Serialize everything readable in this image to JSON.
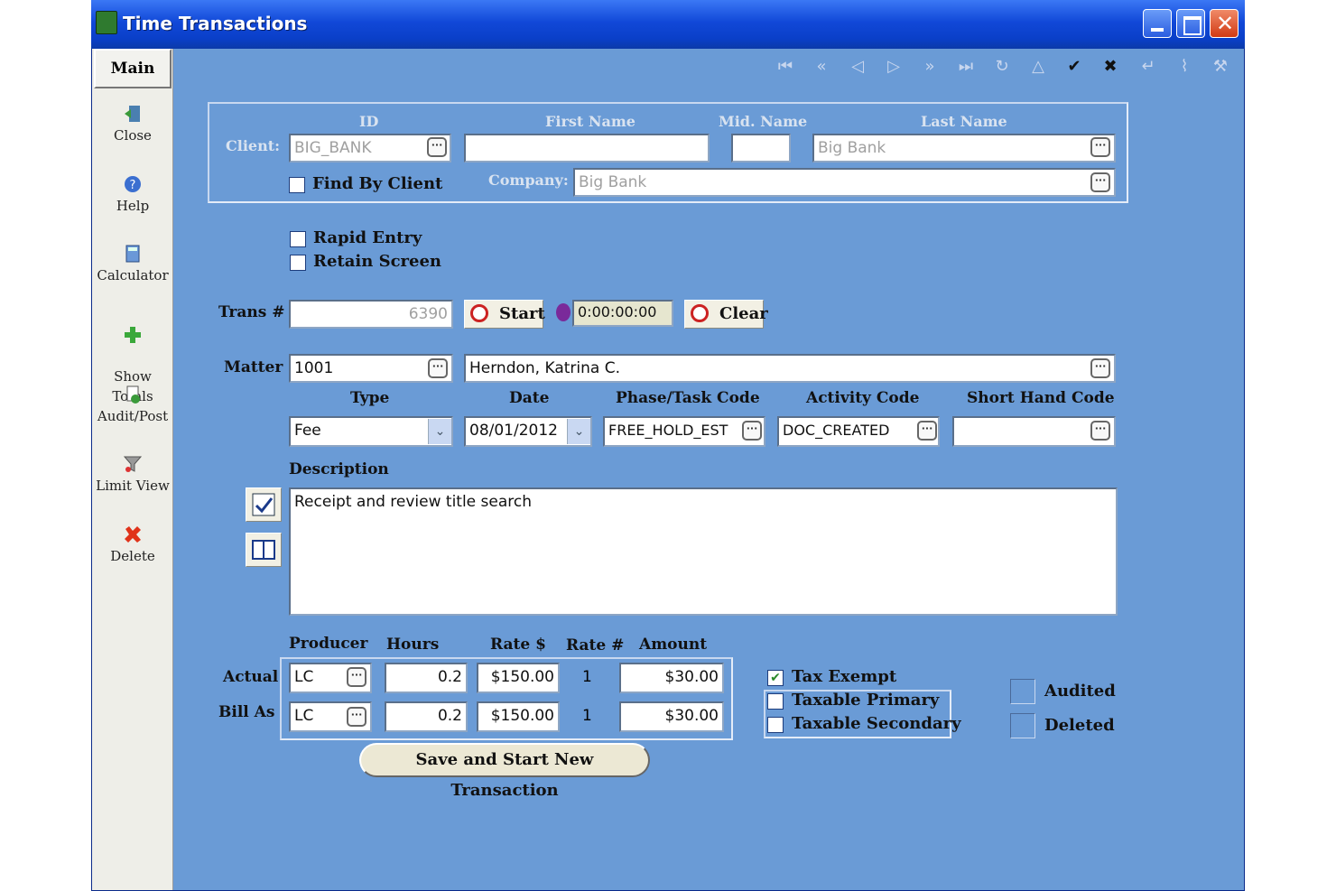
{
  "window": {
    "title": "Time Transactions"
  },
  "sidebar": {
    "main_tab": "Main",
    "items": [
      {
        "label": "Close",
        "icon": "close-door-icon"
      },
      {
        "label": "Help",
        "icon": "help-icon"
      },
      {
        "label": "Calculator",
        "icon": "calculator-icon"
      },
      {
        "label": "Show\nTotals",
        "icon": "plus-icon"
      },
      {
        "label": "Audit/Post",
        "icon": "audit-icon"
      },
      {
        "label": "Limit View",
        "icon": "filter-icon"
      },
      {
        "label": "Delete",
        "icon": "delete-x-icon"
      }
    ]
  },
  "toolbar": {
    "icons": [
      "first-record-icon",
      "prev-page-icon",
      "prev-record-icon",
      "next-record-icon",
      "next-page-icon",
      "last-record-icon",
      "refresh-icon",
      "up-icon",
      "check-icon",
      "cancel-icon",
      "undo-icon",
      "attach-icon",
      "tools-icon"
    ]
  },
  "client": {
    "headers": {
      "id": "ID",
      "first": "First Name",
      "mid": "Mid. Name",
      "last": "Last Name"
    },
    "label": "Client:",
    "id_value": "BIG_BANK",
    "first_value": "",
    "mid_value": "",
    "last_value": "Big Bank",
    "find_by_client": "Find By Client",
    "company_label": "Company:",
    "company_value": "Big Bank"
  },
  "options": {
    "rapid_entry": "Rapid Entry",
    "retain_screen": "Retain Screen"
  },
  "trans": {
    "label": "Trans #",
    "value": "6390",
    "start": "Start",
    "timer": "0:00:00:00",
    "clear": "Clear"
  },
  "matter": {
    "label": "Matter",
    "id": "1001",
    "name": "Herndon, Katrina C.",
    "type_label": "Type",
    "date_label": "Date",
    "phase_label": "Phase/Task Code",
    "activity_label": "Activity Code",
    "shorthand_label": "Short Hand Code",
    "type_value": "Fee",
    "date_value": "08/01/2012",
    "phase_value": "FREE_HOLD_EST",
    "activity_value": "DOC_CREATED",
    "shorthand_value": ""
  },
  "description": {
    "label": "Description",
    "value": "Receipt and review title search"
  },
  "amounts": {
    "headers": {
      "producer": "Producer",
      "hours": "Hours",
      "rate": "Rate $",
      "rate_num": "Rate #",
      "amount": "Amount"
    },
    "actual": {
      "label": "Actual",
      "producer": "LC",
      "hours": "0.2",
      "rate": "$150.00",
      "rate_num": "1",
      "amount": "$30.00"
    },
    "bill_as": {
      "label": "Bill As",
      "producer": "LC",
      "hours": "0.2",
      "rate": "$150.00",
      "rate_num": "1",
      "amount": "$30.00"
    }
  },
  "tax": {
    "exempt": "Tax Exempt",
    "primary": "Taxable Primary",
    "secondary": "Taxable Secondary",
    "exempt_checked": true
  },
  "flags": {
    "audited": "Audited",
    "deleted": "Deleted"
  },
  "save_button": "Save and Start New Transaction"
}
